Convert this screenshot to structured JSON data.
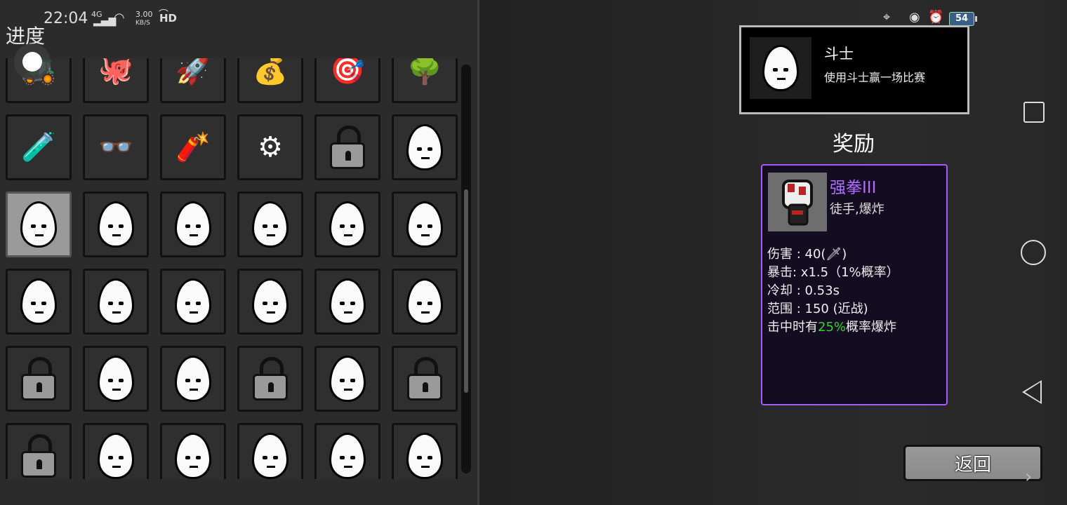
{
  "status_bar": {
    "time": "22:04",
    "network": "4G",
    "speed_value": "3.00",
    "speed_unit": "KB/S",
    "hd": "HD",
    "battery": "54",
    "icons": [
      "signal-icon",
      "wifi-icon",
      "headset-icon",
      "gamepad-icon",
      "rotation-lock-icon",
      "alarm-icon",
      "battery-icon"
    ]
  },
  "progress_title": "进度",
  "grid": {
    "rows": [
      [
        "vehicle",
        "tentacle",
        "rocket",
        "money-bag",
        "target-stand",
        "tree"
      ],
      [
        "flask",
        "glasses",
        "dynamite",
        "sewing-machine",
        "lock",
        "egg-frown"
      ],
      [
        "egg-bruised",
        "egg-smirk",
        "egg-monocle",
        "egg-old-beard",
        "egg-smile",
        "egg-mustache"
      ],
      [
        "egg-dazed",
        "egg-dots",
        "egg-unshaven",
        "egg-shout",
        "egg-tongue",
        "egg-sad"
      ],
      [
        "lock",
        "egg-angry",
        "egg-kiss",
        "lock",
        "egg-goatee",
        "lock"
      ],
      [
        "lock",
        "egg-suit",
        "egg-helmet",
        "egg-bearded",
        "egg-mask",
        "egg-ninja"
      ]
    ],
    "selected": {
      "row": 2,
      "col": 0
    }
  },
  "achievement": {
    "name": "斗士",
    "description": "使用斗士赢一场比赛"
  },
  "reward_heading": "奖励",
  "reward": {
    "name": "强拳III",
    "tags": "徒手,爆炸",
    "stats": [
      "伤害 : 40(🗡)",
      "暴击:  x1.5（1%概率）",
      "冷却 : 0.53s",
      "范围 : 150 (近战)"
    ],
    "effect_prefix": "击中时有",
    "effect_highlight": "25%",
    "effect_suffix": "概率爆炸"
  },
  "back_button": "返回",
  "colors": {
    "accent_purple": "#a45cff",
    "highlight_green": "#2ed52e"
  }
}
